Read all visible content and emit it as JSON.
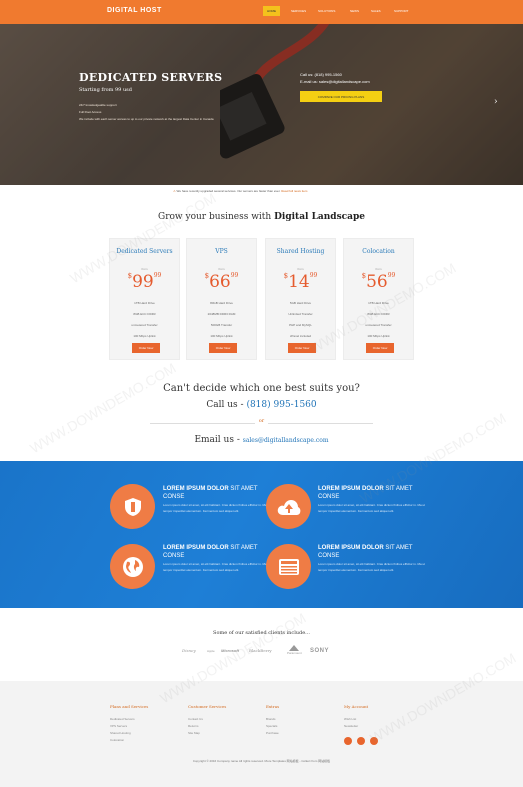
{
  "header": {
    "logo": "DIGITAL HOST",
    "nav": [
      "HOME",
      "SERVICES",
      "SOLUTIONS",
      "NEWS",
      "SALES",
      "SUPPORT"
    ]
  },
  "hero": {
    "title": "DEDICATED SERVERS",
    "subtitle": "Starting from 99 usd",
    "lines": [
      "24/7 knowledgeable support",
      "Full Root Access",
      "We include with each server access to up to our private network at the largest Data Center in Canada"
    ],
    "call": "Call us: (818) 995-1560",
    "email": "E-mail us: sales@digitallandscape.com",
    "button": "COMPARE OUR PRICING PLANS"
  },
  "notice": {
    "text": "We have recently upgraded several services. Our servers are faster than ever.",
    "link": "Read full news item"
  },
  "grow": {
    "prefix": "Grow your business with",
    "brand": "Digital Landscape"
  },
  "plans": [
    {
      "title": "Dedicated Servers",
      "from": "from",
      "dollars": "99",
      "cents": "99",
      "features": [
        "1TB Hard Drive",
        "8GB ECC DDR3",
        "unmetered Transfer",
        "100 Mbps Uplink"
      ],
      "button": "Order Now"
    },
    {
      "title": "VPS",
      "from": "from",
      "dollars": "66",
      "cents": "99",
      "features": [
        "80GB Hard Drive",
        "2048MB DDR3 RAM",
        "500GB Transfer",
        "100 Mbps Uplink"
      ],
      "button": "Order Now"
    },
    {
      "title": "Shared Hosting",
      "from": "from",
      "dollars": "14",
      "cents": "99",
      "features": [
        "5GB Hard Drive",
        "Unlimited Transfer",
        "PHP and MySQL",
        "cPanel included"
      ],
      "button": "Order Now"
    },
    {
      "title": "Colocation",
      "from": "from",
      "dollars": "56",
      "cents": "99",
      "features": [
        "1TB Hard Drive",
        "8GB ECC DDR3",
        "unmetered Transfer",
        "100 Mbps Uplink"
      ],
      "button": "Order Now"
    }
  ],
  "contact": {
    "question": "Can't decide which one best suits you?",
    "call_prefix": "Call us -",
    "phone": "(818) 995-1560",
    "or": "or",
    "email_prefix": "Email us -",
    "email": "sales@digitallandscape.com"
  },
  "features": [
    {
      "title_bold": "LOREM IPSUM DOLOR",
      "title_rest": "SIT AMET CONSE",
      "text": "Lorem ipsum dolor sit amet, sit elit habitant. Cras dictum finibus efficitur in. Ma ut tempor imperdiet elementum. Fermentum sed aliquet elit.",
      "icon": "shield-icon"
    },
    {
      "title_bold": "LOREM IPSUM DOLOR",
      "title_rest": "SIT AMET CONSE",
      "text": "Lorem ipsum dolor sit amet, sit elit habitant. Cras dictum finibus efficitur in. Ma ut tempor imperdiet elementum. Fermentum sed aliquet elit.",
      "icon": "cloud-upload-icon"
    },
    {
      "title_bold": "LOREM IPSUM DOLOR",
      "title_rest": "SIT AMET CONSE",
      "text": "Lorem ipsum dolor sit amet, sit elit habitant. Cras dictum finibus efficitur in. Ma ut tempor imperdiet elementum. Fermentum sed aliquet elit.",
      "icon": "globe-icon"
    },
    {
      "title_bold": "LOREM IPSUM DOLOR",
      "title_rest": "SIT AMET CONSE",
      "text": "Lorem ipsum dolor sit amet, sit elit habitant. Cras dictum finibus efficitur in. Ma ut tempor imperdiet elementum. Fermentum sed aliquet elit.",
      "icon": "server-list-icon"
    }
  ],
  "clients": {
    "title": "Some of our satisfied clients include...",
    "names": [
      "Disney",
      "Apple",
      "Microsoft",
      "BlackBerry",
      "Paramount",
      "SONY"
    ]
  },
  "footer": {
    "columns": [
      {
        "title": "Plans and Services",
        "items": [
          "Dedicated Servers",
          "VPS Servers",
          "Shared Hosting",
          "Colocation"
        ]
      },
      {
        "title": "Customer Services",
        "items": [
          "Contact Us",
          "Returns",
          "Site Map"
        ]
      },
      {
        "title": "Extras",
        "items": [
          "Brands",
          "Specials",
          "Purchase"
        ]
      },
      {
        "title": "My Account",
        "items": [
          "Wish List",
          "Newsletter"
        ]
      }
    ],
    "copyright": "Copyright © 2016 Company name All rights reserved. More Templates 网站模板 - Collect from 网站模板"
  },
  "watermark": "WWW.DOWNDEMO.COM",
  "colors": {
    "orange": "#f07a2f",
    "blue": "#1e7fd6",
    "accent_text": "#1f73b7"
  }
}
